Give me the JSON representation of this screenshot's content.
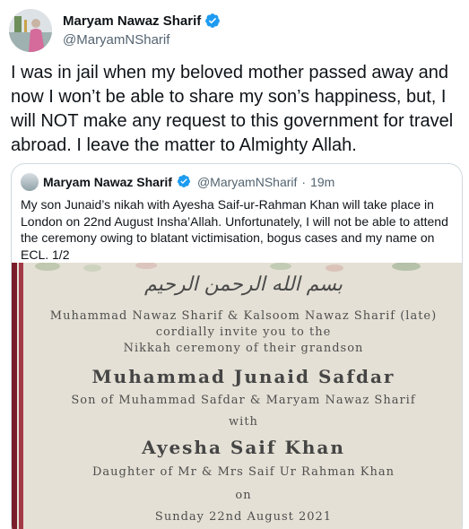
{
  "tweet": {
    "display_name": "Maryam Nawaz Sharif",
    "handle": "@MaryamNSharif",
    "text": "I was in jail when my beloved mother passed away and now I won’t be able to share my son’s happiness, but, I will NOT make any request to this government for travel abroad. I leave the matter to Almighty Allah."
  },
  "quote": {
    "display_name": "Maryam Nawaz Sharif",
    "handle": "@MaryamNSharif",
    "separator": "·",
    "time": "19m",
    "text": "My son Junaid’s nikah with Ayesha Saif-ur-Rahman Khan will take place in London on 22nd August Insha’Allah. Unfortunately, I will not be able to attend the ceremony owing to blatant victimisation, bogus cases and my name on ECL. 1/2"
  },
  "invitation": {
    "arabic": "بسم الله الرحمن الرحيم",
    "line1": "Muhammad Nawaz Sharif & Kalsoom Nawaz Sharif (late)",
    "line2": "cordially invite you to the",
    "line3": "Nikkah ceremony of their grandson",
    "groom": "Muhammad Junaid Safdar",
    "groom_parents": "Son of Muhammad Safdar & Maryam Nawaz Sharif",
    "with": "with",
    "bride": "Ayesha Saif Khan",
    "bride_parents": "Daughter of Mr & Mrs Saif Ur Rahman Khan",
    "on": "on",
    "date": "Sunday 22nd August 2021"
  },
  "colors": {
    "verified": "#1d9bf0",
    "secondary_text": "#536471",
    "border": "#cfd9de",
    "card_bg": "#e4e0d5",
    "card_accent": "#7a1d2a"
  },
  "icons": {
    "verified": "verified-badge-icon"
  }
}
